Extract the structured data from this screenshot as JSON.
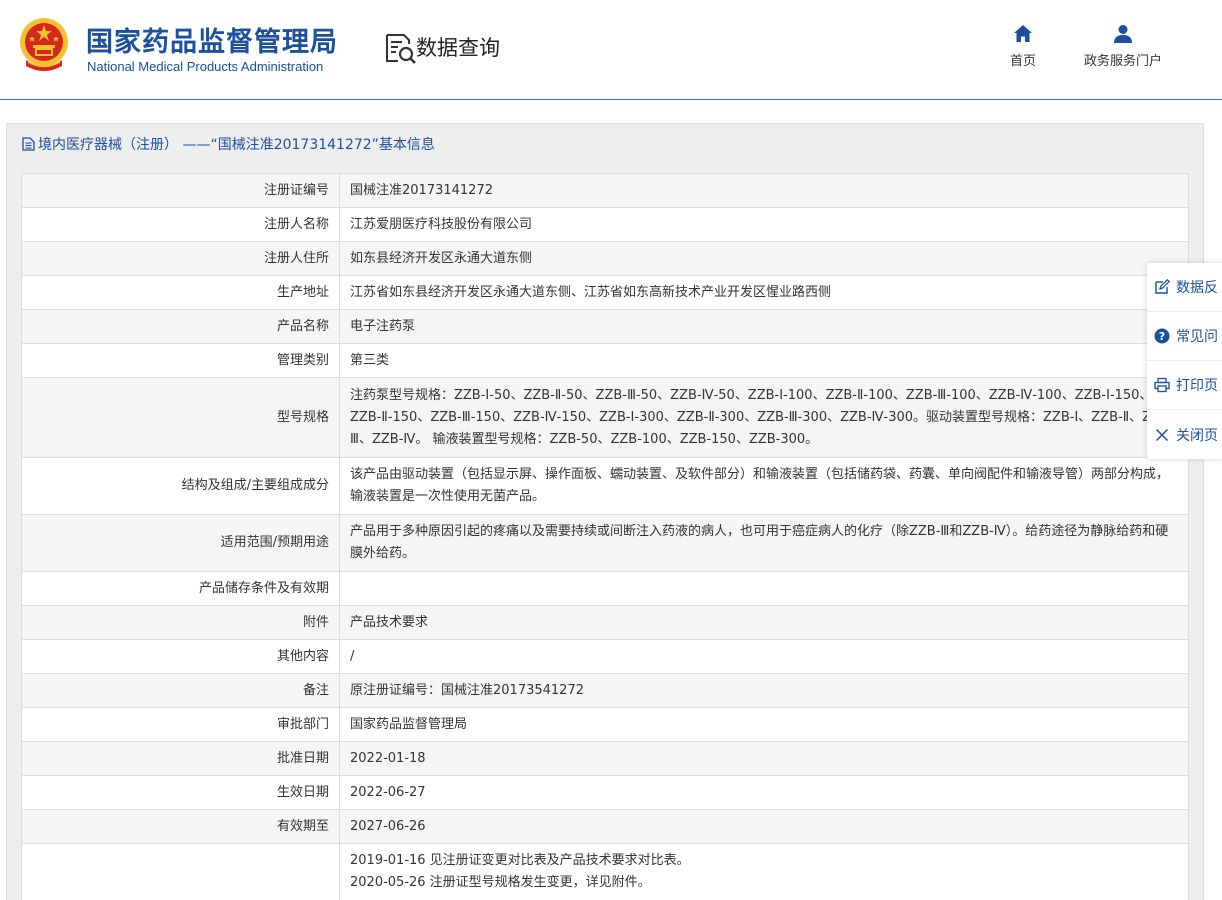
{
  "header": {
    "org_name_cn": "国家药品监督管理局",
    "org_name_en": "National Medical Products Administration",
    "query_title": "数据查询",
    "nav": [
      {
        "label": "首页",
        "icon": "home-icon"
      },
      {
        "label": "政务服务门户",
        "icon": "user-icon"
      }
    ]
  },
  "panel": {
    "title": "境内医疗器械（注册） ——“国械注准20173141272”基本信息"
  },
  "rows": [
    {
      "label": "注册证编号",
      "value": "国械注准20173141272"
    },
    {
      "label": "注册人名称",
      "value": "江苏爱朋医疗科技股份有限公司"
    },
    {
      "label": "注册人住所",
      "value": "如东县经济开发区永通大道东侧"
    },
    {
      "label": "生产地址",
      "value": "江苏省如东县经济开发区永通大道东侧、江苏省如东高新技术产业开发区惺业路西侧"
    },
    {
      "label": "产品名称",
      "value": "电子注药泵"
    },
    {
      "label": "管理类别",
      "value": "第三类"
    },
    {
      "label": "型号规格",
      "value": "注药泵型号规格：ZZB-Ⅰ-50、ZZB-Ⅱ-50、ZZB-Ⅲ-50、ZZB-Ⅳ-50、ZZB-Ⅰ-100、ZZB-Ⅱ-100、ZZB-Ⅲ-100、ZZB-Ⅳ-100、ZZB-Ⅰ-150、ZZB-Ⅱ-150、ZZB-Ⅲ-150、ZZB-Ⅳ-150、ZZB-Ⅰ-300、ZZB-Ⅱ-300、ZZB-Ⅲ-300、ZZB-Ⅳ-300。驱动装置型号规格：ZZB-Ⅰ、ZZB-Ⅱ、ZZB-Ⅲ、ZZB-Ⅳ。 输液装置型号规格：ZZB-50、ZZB-100、ZZB-150、ZZB-300。"
    },
    {
      "label": "结构及组成/主要组成成分",
      "value": "该产品由驱动装置（包括显示屏、操作面板、蠕动装置、及软件部分）和输液装置（包括储药袋、药囊、单向阀配件和输液导管）两部分构成，输液装置是一次性使用无菌产品。"
    },
    {
      "label": "适用范围/预期用途",
      "value": "产品用于多种原因引起的疼痛以及需要持续或间断注入药液的病人，也可用于癌症病人的化疗（除ZZB-Ⅲ和ZZB-Ⅳ）。给药途径为静脉给药和硬膜外给药。"
    },
    {
      "label": "产品储存条件及有效期",
      "value": ""
    },
    {
      "label": "附件",
      "value": "产品技术要求"
    },
    {
      "label": "其他内容",
      "value": "/"
    },
    {
      "label": "备注",
      "value": "原注册证编号：国械注准20173541272"
    },
    {
      "label": "审批部门",
      "value": "国家药品监督管理局"
    },
    {
      "label": "批准日期",
      "value": "2022-01-18"
    },
    {
      "label": "生效日期",
      "value": "2022-06-27"
    },
    {
      "label": "有效期至",
      "value": "2027-06-26"
    }
  ],
  "change_history": [
    "2019-01-16 见注册证变更对比表及产品技术要求对比表。",
    "2020-05-26 注册证型号规格发生变更，详见附件。"
  ],
  "toolbar": {
    "feedback": "数据反",
    "faq": "常见问",
    "print": "打印页",
    "close": "关闭页"
  },
  "colors": {
    "brand_blue": "#1b4fa0",
    "emblem_red": "#d7261c",
    "emblem_gold": "#f2c230",
    "row_zebra": "#f5f5f5",
    "panel_bg": "#eeeeee"
  }
}
